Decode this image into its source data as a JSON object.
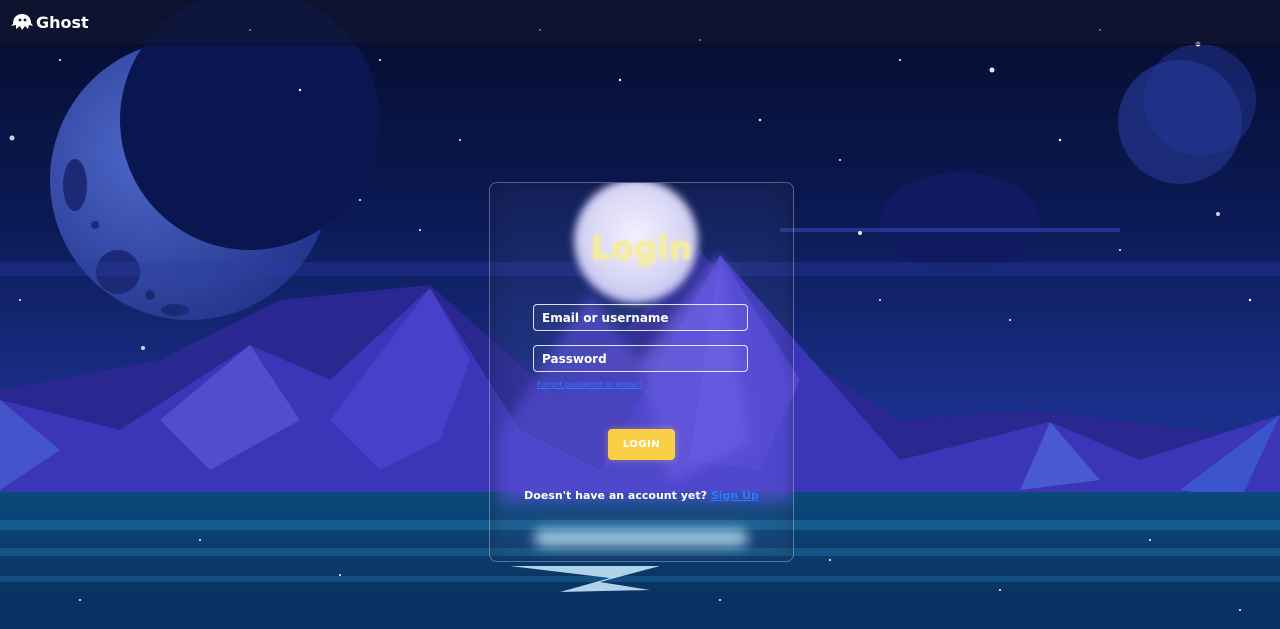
{
  "header": {
    "brand_name": "Ghost",
    "logo_icon": "ghost-icon"
  },
  "login": {
    "title": "Login",
    "email_placeholder": "Email or username",
    "password_placeholder": "Password",
    "forgot_link": "Forgot password or email?",
    "submit_label": "LOGIN",
    "signup_prompt": "Doesn't have an account yet?",
    "signup_link": "Sign Up"
  },
  "colors": {
    "accent_button": "#f9cf45",
    "link": "#2b7bff",
    "title": "#f6eba0",
    "sky_top": "#071238",
    "sky_mid": "#14267a",
    "water": "#0b3d6a"
  }
}
